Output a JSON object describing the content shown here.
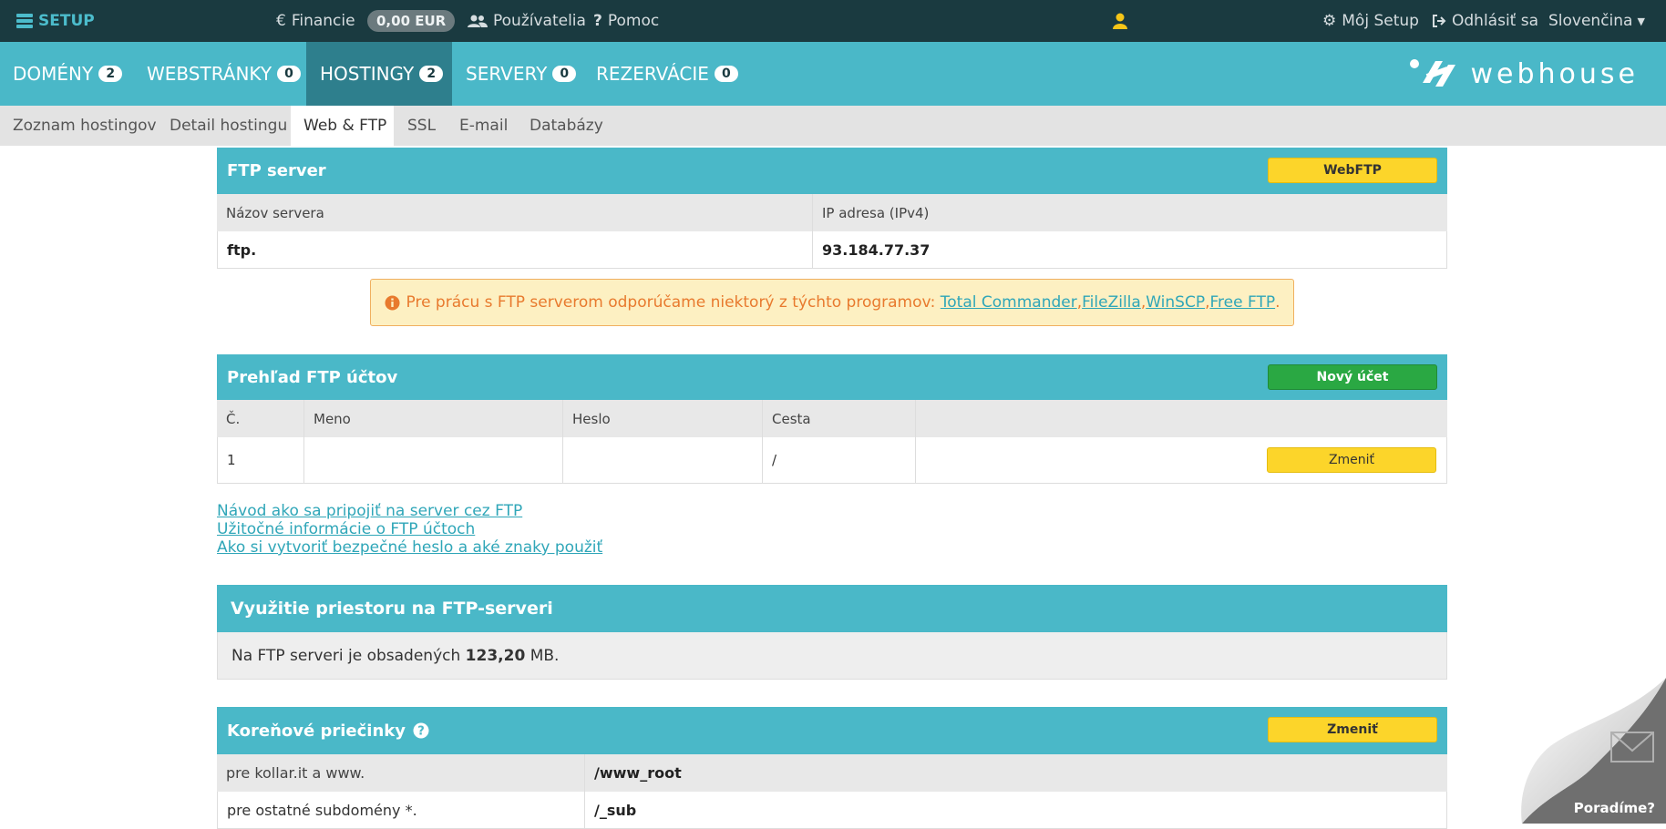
{
  "topbar": {
    "logo_label": "SETUP",
    "financie_label": "Financie",
    "balance": "0,00 EUR",
    "users_label": "Používatelia",
    "help_label": "Pomoc",
    "my_setup_label": "Môj Setup",
    "logout_label": "Odhlásiť sa",
    "language_label": "Slovenčina",
    "bg_color": "#1a3a40",
    "user_icon_color": "#f5c518"
  },
  "nav": {
    "tabs": [
      {
        "label": "DOMÉNY",
        "count": "2"
      },
      {
        "label": "WEBSTRÁNKY",
        "count": "0"
      },
      {
        "label": "HOSTINGY",
        "count": "2"
      },
      {
        "label": "SERVERY",
        "count": "0"
      },
      {
        "label": "REZERVÁCIE",
        "count": "0"
      }
    ],
    "active_tab": "HOSTINGY",
    "brand": "webhouse",
    "accent_color": "#4ab8c8"
  },
  "subnav": {
    "tabs": [
      "Zoznam hostingov",
      "Detail hostingu",
      "Web & FTP",
      "SSL",
      "E-mail",
      "Databázy"
    ],
    "active_tab": "Web & FTP"
  },
  "ftp_server": {
    "title": "FTP server",
    "webftp_button": "WebFTP",
    "col_server_name": "Názov servera",
    "col_ip": "IP adresa (IPv4)",
    "server_name": "ftp.",
    "ip": "93.184.77.37"
  },
  "alert": {
    "text": "Pre prácu s FTP serverom odporúčame niektorý z týchto programov:",
    "programs": [
      "Total Commander",
      "FileZilla",
      "WinSCP",
      "Free FTP"
    ],
    "sep": ", ",
    "end": "."
  },
  "ftp_accounts": {
    "title": "Prehľad FTP účtov",
    "new_account_button": "Nový účet",
    "columns": [
      "Č.",
      "Meno",
      "Heslo",
      "Cesta"
    ],
    "rows": [
      {
        "num": "1",
        "name": "",
        "password": "",
        "path": "/",
        "action": "Zmeniť"
      }
    ]
  },
  "help_links": [
    "Návod ako sa pripojiť na server cez FTP",
    "Užitočné informácie o FTP účtoch",
    "Ako si vytvoriť bezpečné heslo a aké znaky použiť"
  ],
  "usage": {
    "title": "Využitie priestoru na FTP-serveri",
    "text_before": "Na FTP serveri je obsadených",
    "value": "123,20",
    "unit": "MB."
  },
  "root_folders": {
    "title": "Koreňové priečinky",
    "change_button": "Zmeniť",
    "rows": [
      {
        "label": "pre kollar.it a www.",
        "value": "/www_root"
      },
      {
        "label": "pre ostatné subdomény *.",
        "value": "/_sub"
      }
    ]
  },
  "help_corner": {
    "label": "Poradíme?"
  }
}
